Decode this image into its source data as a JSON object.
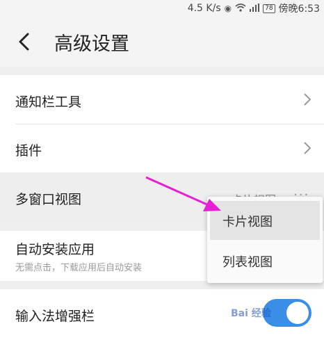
{
  "status_bar": {
    "speed": "4.5 K/s",
    "battery": "78",
    "time": "傍晚6:53",
    "icons": [
      "eye-icon",
      "wifi-icon",
      "signal-icon",
      "battery-icon"
    ]
  },
  "header": {
    "title": "高级设置",
    "back_icon": "chevron-left-icon"
  },
  "settings": {
    "notif_tools": "通知栏工具",
    "plugins": "插件",
    "multiwindow": {
      "label": "多窗口视图",
      "value": "卡片视图"
    },
    "auto_install": {
      "label": "自动安装应用",
      "desc": "无需点击，下载应用后自动安装"
    },
    "ime_bar": {
      "label": "输入法增强栏",
      "enabled": true
    }
  },
  "popup_menu": {
    "options": [
      "卡片视图",
      "列表视图"
    ],
    "selected": "卡片视图"
  },
  "colors": {
    "accent": "#3a8ee6",
    "arrow": "#e61fd3",
    "background": "#efefef"
  },
  "watermark": "Bai 经验"
}
